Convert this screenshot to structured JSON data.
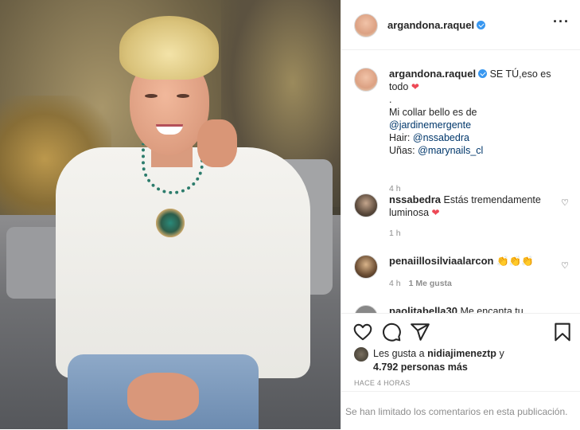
{
  "post": {
    "username": "argandona.raquel",
    "caption_text": "SE TÚ,eso es todo",
    "caption_dot": ".",
    "caption_line2": "Mi collar bello es de",
    "mention1": "@jardinemergente",
    "hair_label": "Hair:",
    "mention2": "@nssabedra",
    "nails_label": "Uñas:",
    "mention3": "@marynails_cl",
    "caption_time": "4 h"
  },
  "comments": [
    {
      "username": "nssabedra",
      "text": "Estás tremendamente luminosa",
      "time": "1 h"
    },
    {
      "username": "penaiillosilviaalarcon",
      "text": "👏👏👏",
      "time": "4 h",
      "likes": "1 Me gusta"
    },
    {
      "username": "paolitabella30",
      "text": "Me encanta tu"
    }
  ],
  "likes": {
    "prefix": "Les gusta a",
    "user": "nidiajimeneztp",
    "conj": "y",
    "count": "4.792 personas más"
  },
  "post_time": "HACE 4 HORAS",
  "footer": "Se han limitado los comentarios en esta publicación.",
  "icons": [
    "heart-icon",
    "comment-icon",
    "share-icon",
    "bookmark-icon",
    "more-icon",
    "verified-badge-icon"
  ],
  "colors": {
    "verified": "#3897f0",
    "link": "#00376b",
    "heart": "#ed4956",
    "muted": "#8e8e8e"
  }
}
